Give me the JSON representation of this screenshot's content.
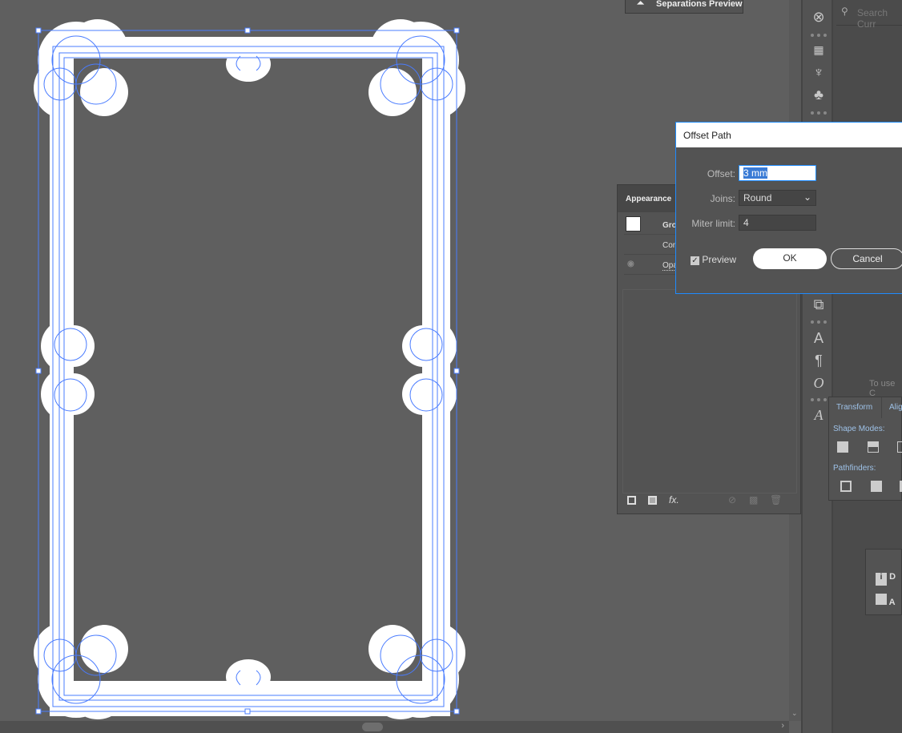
{
  "separations_preview": {
    "label": "Separations Preview",
    "icon": "separations-icon"
  },
  "search": {
    "placeholder": "Search Curr"
  },
  "toolbar_icons": [
    "symbols-icon",
    "swatches-icon",
    "brushes-icon",
    "club-symbol-icon",
    "transform-icon",
    "character-icon",
    "paragraph-icon",
    "opentype-icon",
    "glyphs-icon"
  ],
  "appearance": {
    "title": "Appearance",
    "rows": [
      {
        "label": "Gro"
      },
      {
        "label": "Con"
      },
      {
        "label": "Opa"
      }
    ],
    "footer_icons": [
      "new-stroke-icon",
      "new-fill-icon",
      "fx-icon",
      "clear-icon",
      "duplicate-icon",
      "trash-icon"
    ],
    "fx_label": "fx."
  },
  "dialog": {
    "title": "Offset Path",
    "offset_label": "Offset:",
    "offset_value": "3 mm",
    "joins_label": "Joins:",
    "joins_value": "Round",
    "miter_label": "Miter limit:",
    "miter_value": "4",
    "preview_label": "Preview",
    "preview_checked": true,
    "ok_label": "OK",
    "cancel_label": "Cancel",
    "accent": "#1e8bff"
  },
  "pathfinder": {
    "tabs": [
      "Transform",
      "Alig"
    ],
    "shape_modes_label": "Shape Modes:",
    "pathfinders_label": "Pathfinders:"
  },
  "hint_text": "To use C",
  "lower_panel": {
    "items": [
      {
        "label": "D",
        "icon": "document-info-icon"
      },
      {
        "label": "A",
        "icon": "attributes-icon"
      }
    ]
  },
  "colors": {
    "canvas": "#5f5f5f",
    "selection": "#4a7cff",
    "art": "#ffffff"
  }
}
